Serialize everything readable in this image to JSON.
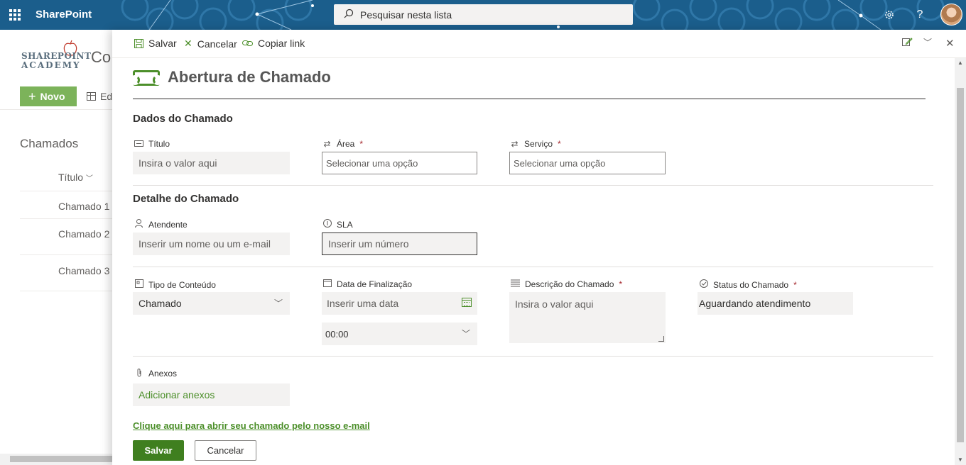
{
  "suite": {
    "app_name": "SharePoint",
    "search_placeholder": "Pesquisar nesta lista",
    "icons": [
      "waffle-icon",
      "search-icon",
      "settings-icon",
      "help-icon"
    ],
    "help_glyph": "?"
  },
  "background_page": {
    "logo_line1": "SHAREPOINT",
    "logo_line2": "ACADEMY",
    "site_title": "Co",
    "new_button": "Novo",
    "edit_grid_label": "Ed",
    "list_name": "Chamados",
    "column_header": "Título",
    "rows": [
      "Chamado 1",
      "Chamado 2",
      "Chamado 3"
    ]
  },
  "panel": {
    "commands": {
      "save": "Salvar",
      "cancel": "Cancelar",
      "copy_link": "Copiar link"
    },
    "form_title": "Abertura de Chamado",
    "sections": {
      "dados": "Dados do Chamado",
      "detalhe": "Detalhe do Chamado"
    },
    "fields": {
      "titulo": {
        "label": "Título",
        "placeholder": "Insira o valor aqui"
      },
      "area": {
        "label": "Área",
        "required": "*",
        "placeholder": "Selecionar uma opção"
      },
      "servico": {
        "label": "Serviço",
        "required": "*",
        "placeholder": "Selecionar uma opção"
      },
      "atendente": {
        "label": "Atendente",
        "placeholder": "Inserir um nome ou um e-mail"
      },
      "sla": {
        "label": "SLA",
        "placeholder": "Inserir um número"
      },
      "tipo": {
        "label": "Tipo de Conteúdo",
        "value": "Chamado"
      },
      "data": {
        "label": "Data de Finalização",
        "placeholder": "Inserir uma data",
        "time": "00:00"
      },
      "descricao": {
        "label": "Descrição do Chamado",
        "required": "*",
        "placeholder": "Insira o valor aqui"
      },
      "status": {
        "label": "Status do Chamado",
        "required": "*",
        "value": "Aguardando atendimento"
      },
      "anexos": {
        "label": "Anexos",
        "action": "Adicionar anexos"
      }
    },
    "email_link": "Clique aqui para abrir seu chamado pelo nosso e-mail",
    "buttons": {
      "save": "Salvar",
      "cancel": "Cancelar"
    }
  },
  "colors": {
    "suite_bar": "#1b5e8c",
    "accent_green": "#4c8f2a",
    "save_button": "#3f7f1f",
    "required_red": "#a4262c"
  }
}
